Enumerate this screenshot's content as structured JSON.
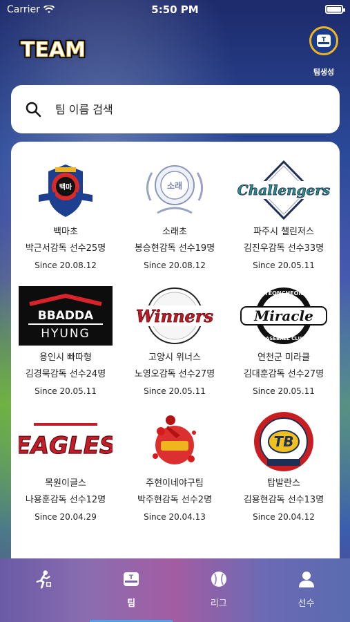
{
  "status": {
    "carrier": "Carrier",
    "time": "5:50 PM"
  },
  "header": {
    "title": "TEAM",
    "create_label": "팀생성"
  },
  "search": {
    "placeholder": "팀 이름 검색"
  },
  "teams": [
    {
      "name": "백마초",
      "coach": "박근서감독 선수25명",
      "since": "Since 20.08.12",
      "logo": "shield-badge",
      "logo_text": "백마"
    },
    {
      "name": "소래초",
      "coach": "봉승현감독 선수19명",
      "since": "Since 20.08.12",
      "logo": "school-emblem",
      "logo_text": "소래"
    },
    {
      "name": "파주시 챌린저스",
      "coach": "김진우감독 선수33명",
      "since": "Since 20.05.11",
      "logo": "challengers-diamond",
      "logo_text": "Challengers"
    },
    {
      "name": "용인시 빠따형",
      "coach": "김경묵감독 선수24명",
      "since": "Since 20.05.11",
      "logo": "bbadda-banner",
      "logo_text": "BBADDA HYUNG"
    },
    {
      "name": "고양시 위너스",
      "coach": "노영오감독 선수27명",
      "since": "Since 20.05.11",
      "logo": "winners-script",
      "logo_text": "Winners"
    },
    {
      "name": "연천군 미라클",
      "coach": "김대훈감독 선수27명",
      "since": "Since 20.05.11",
      "logo": "miracle-circle",
      "logo_text": "Miracle"
    },
    {
      "name": "목원이글스",
      "coach": "나용훈감독 선수12명",
      "since": "Since 20.04.29",
      "logo": "eagles-wordmark",
      "logo_text": "EAGLES"
    },
    {
      "name": "주현이네야구팀",
      "coach": "박주현감독 선수2명",
      "since": "Since 20.04.13",
      "logo": "splatter-player",
      "logo_text": ""
    },
    {
      "name": "탑발란스",
      "coach": "김용현감독 선수13명",
      "since": "Since 20.04.12",
      "logo": "tb-circle",
      "logo_text": "TB"
    }
  ],
  "tabs": [
    {
      "label": "",
      "icon": "runner-icon"
    },
    {
      "label": "팀",
      "icon": "team-cap-icon",
      "active": true
    },
    {
      "label": "리그",
      "icon": "baseball-icon"
    },
    {
      "label": "선수",
      "icon": "person-icon"
    }
  ],
  "colors": {
    "accent": "#4fa3e8",
    "badge_gold": "#f0b51e",
    "badge_blue": "#1b3b8c"
  }
}
